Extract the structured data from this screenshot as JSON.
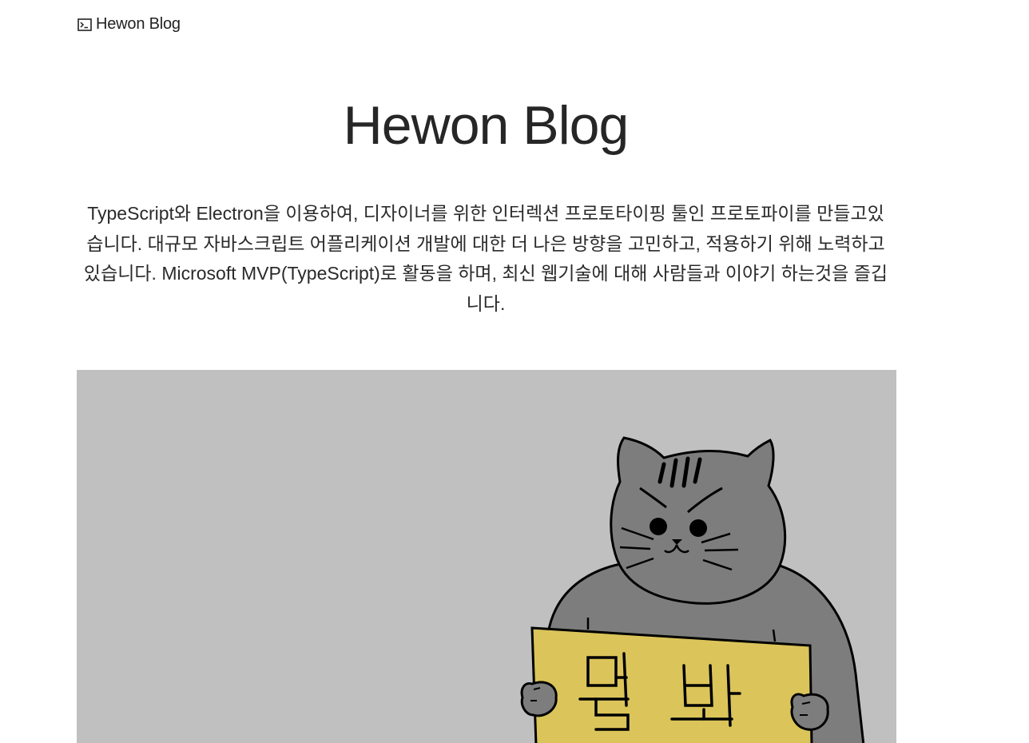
{
  "nav": {
    "brand": "Hewon Blog",
    "icon": "terminal-icon"
  },
  "hero": {
    "title": "Hewon Blog",
    "intro": "TypeScript와 Electron을 이용하여, 디자이너를 위한 인터렉션 프로토타이핑 툴인 프로토파이를 만들고있습니다. 대규모 자바스크립트 어플리케이션 개발에 대한 더 나은 방향을 고민하고, 적용하기 위해 노력하고 있습니다. Microsoft MVP(TypeScript)로 활동을 하며, 최신 웹기술에 대해 사람들과 이야기 하는것을 즐깁니다."
  },
  "cover": {
    "sign_text": "뭘 봐",
    "background": "#c0c0c0",
    "cat_color": "#7d7d7d",
    "sign_color": "#dbc45a"
  }
}
